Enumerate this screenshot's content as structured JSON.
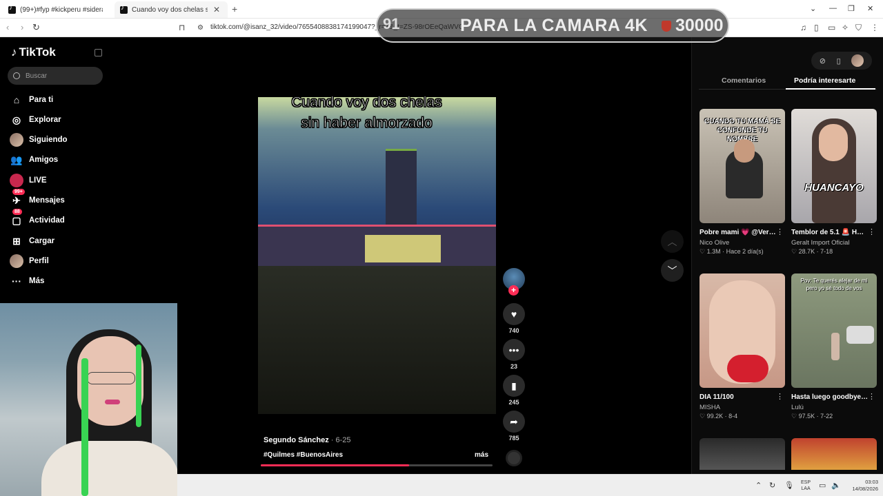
{
  "browser": {
    "tabs": [
      {
        "title": "(99+)#fyp #kickperu #sideral | sidera",
        "active": false
      },
      {
        "title": "Cuando voy dos chelas sin ha",
        "active": true
      }
    ],
    "url": "tiktok.com/@isanz_32/video/7655408838174199047?_r=1&_t=ZS-98rOEeQaWVG"
  },
  "stream_overlay": {
    "number": "91",
    "text": "PARA LA CAMARA 4K",
    "amount": "30000"
  },
  "sidebar": {
    "logo": "TikTok",
    "search_placeholder": "Buscar",
    "items": [
      {
        "label": "Para ti",
        "icon": "home-icon"
      },
      {
        "label": "Explorar",
        "icon": "compass-icon"
      },
      {
        "label": "Siguiendo",
        "icon": "following-avatar-icon"
      },
      {
        "label": "Amigos",
        "icon": "friends-icon"
      },
      {
        "label": "LIVE",
        "icon": "live-icon"
      },
      {
        "label": "Mensajes",
        "icon": "messages-icon",
        "badge": "99+"
      },
      {
        "label": "Actividad",
        "icon": "activity-icon",
        "badge": "88"
      },
      {
        "label": "Cargar",
        "icon": "upload-icon"
      },
      {
        "label": "Perfil",
        "icon": "profile-avatar-icon"
      },
      {
        "label": "Más",
        "icon": "more-icon"
      }
    ]
  },
  "video": {
    "caption_line1": "Cuando voy dos chelas",
    "caption_line2": "sin haber almorzado",
    "author": "Segundo Sánchez",
    "date": "· 6-25",
    "tags": "#Quilmes #BuenosAires",
    "more": "más",
    "progress": 0.64,
    "likes": "740",
    "comments": "23",
    "saves": "245",
    "shares": "785"
  },
  "right_panel": {
    "tabs": [
      "Comentarios",
      "Podría interesarte"
    ],
    "cards": [
      {
        "title": "Pobre mami 💗 @Verigonzalez - ...",
        "author": "Nico Olive",
        "stats": "♡ 1.3M · Hace 2 día(s)",
        "overlay": "CUANDO TU MAMÁ SE CONFUNDE TU NOMBRE"
      },
      {
        "title": "Temblor de 5.1 🚨 HUANCAYO #huancay...",
        "author": "Geralt Import Oficial",
        "stats": "♡ 28.7K · 7-18",
        "overlay": "HUANCAYO"
      },
      {
        "title": "DIA 11/100",
        "author": "MISHA",
        "stats": "♡ 99.2K · 8-4",
        "overlay": ""
      },
      {
        "title": "Hasta luego goodbye #conozcotusecreto 😈 ...",
        "author": "Lulú",
        "stats": "♡ 97.5K · 7-22",
        "overlay": "Pov: Te querés alejar de mi pero yo sé todo de vos"
      }
    ]
  },
  "taskbar": {
    "lang_top": "ESP",
    "lang_bottom": "LAA",
    "time": "03:03",
    "date": "14/08/2026"
  }
}
